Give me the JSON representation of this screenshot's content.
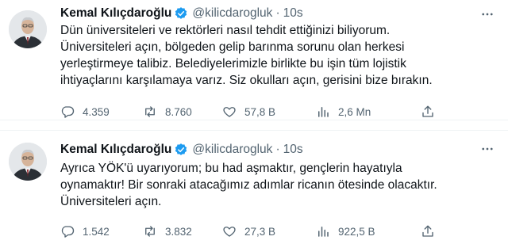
{
  "tweets": [
    {
      "name": "Kemal Kılıçdaroğlu",
      "handle": "@kilicdarogluk",
      "separator": "·",
      "time": "10s",
      "text_lines": [
        "Dün üniversiteleri ve rektörleri nasıl tehdit ettiğinizi biliyorum.",
        "Üniversiteleri açın, bölgeden gelip barınma sorunu olan herkesi",
        "yerleştirmeye talibiz. Belediyelerimizle birlikte bu işin tüm lojistik",
        "ihtiyaçlarını karşılamaya varız. Siz okulları açın, gerisini bize bırakın."
      ],
      "replies": "4.359",
      "retweets": "8.760",
      "likes": "57,8 B",
      "views": "2,6 Mn"
    },
    {
      "name": "Kemal Kılıçdaroğlu",
      "handle": "@kilicdarogluk",
      "separator": "·",
      "time": "10s",
      "text_lines": [
        "Ayrıca YÖK'ü uyarıyorum; bu had aşmaktır, gençlerin hayatıyla",
        "oynamaktır! Bir sonraki atacağımız adımlar ricanın ötesinde olacaktır.",
        "Üniversiteleri açın."
      ],
      "replies": "1.542",
      "retweets": "3.832",
      "likes": "27,3 B",
      "views": "922,5 B"
    }
  ],
  "icons": {
    "verified": "verified-badge-icon",
    "more": "more-icon",
    "reply": "reply-icon",
    "retweet": "retweet-icon",
    "like": "heart-icon",
    "views": "views-icon",
    "share": "share-icon"
  },
  "colors": {
    "text": "#0f1419",
    "secondary": "#536471",
    "verified": "#1d9bf0",
    "divider": "#eff3f4"
  }
}
